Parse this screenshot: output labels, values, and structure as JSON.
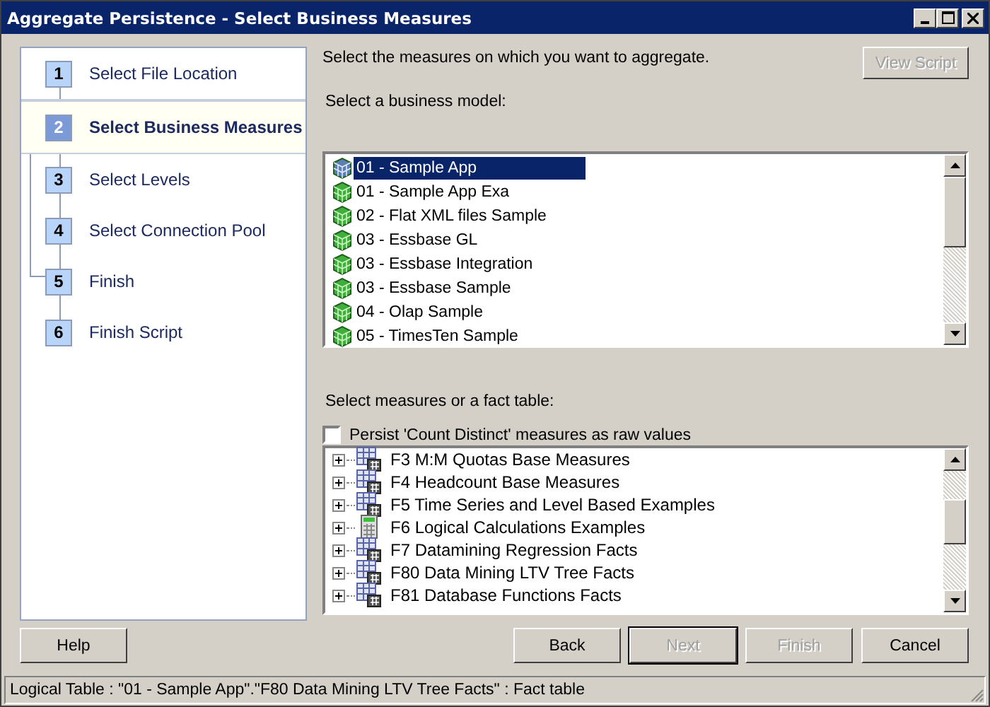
{
  "window": {
    "title": "Aggregate Persistence - Select Business Measures"
  },
  "steps": [
    {
      "number": "1",
      "label": "Select File Location",
      "selected": false
    },
    {
      "number": "2",
      "label": "Select Business Measures",
      "selected": true
    },
    {
      "number": "3",
      "label": "Select Levels",
      "selected": false
    },
    {
      "number": "4",
      "label": "Select Connection Pool",
      "selected": false
    },
    {
      "number": "5",
      "label": "Finish",
      "selected": false
    },
    {
      "number": "6",
      "label": "Finish Script",
      "selected": false
    }
  ],
  "instruction": "Select the measures on which you want to aggregate.",
  "view_script_button": {
    "label": "View Script",
    "disabled": true
  },
  "business_model_label": "Select a business model:",
  "business_models": [
    {
      "label": "01 - Sample App",
      "selected": true
    },
    {
      "label": "01 - Sample App Exa",
      "selected": false
    },
    {
      "label": "02 - Flat XML files Sample",
      "selected": false
    },
    {
      "label": "03 - Essbase GL",
      "selected": false
    },
    {
      "label": "03 - Essbase Integration",
      "selected": false
    },
    {
      "label": "03 - Essbase Sample",
      "selected": false
    },
    {
      "label": "04 - Olap Sample",
      "selected": false
    },
    {
      "label": "05 - TimesTen Sample",
      "selected": false
    }
  ],
  "measures_label": "Select measures or a fact table:",
  "persist_checkbox": {
    "label": "Persist 'Count Distinct' measures as raw values",
    "checked": false
  },
  "fact_tables": [
    {
      "kind": "table",
      "label": "F3 M:M Quotas Base Measures"
    },
    {
      "kind": "table",
      "label": "F4 Headcount Base Measures"
    },
    {
      "kind": "table",
      "label": "F5 Time Series and Level Based Examples"
    },
    {
      "kind": "calc",
      "label": "F6 Logical Calculations Examples"
    },
    {
      "kind": "table",
      "label": "F7 Datamining Regression Facts"
    },
    {
      "kind": "table",
      "label": "F80 Data Mining LTV Tree Facts"
    },
    {
      "kind": "table",
      "label": "F81 Database Functions Facts"
    }
  ],
  "buttons_left": [
    {
      "label": "Help",
      "disabled": false
    }
  ],
  "buttons_right": [
    {
      "label": "Back",
      "disabled": false
    },
    {
      "label": "Next",
      "disabled": true
    },
    {
      "label": "Finish",
      "disabled": true
    },
    {
      "label": "Cancel",
      "disabled": false
    }
  ],
  "status_bar": "Logical Table : \"01 - Sample App\".\"F80 Data Mining LTV Tree Facts\" : Fact table"
}
